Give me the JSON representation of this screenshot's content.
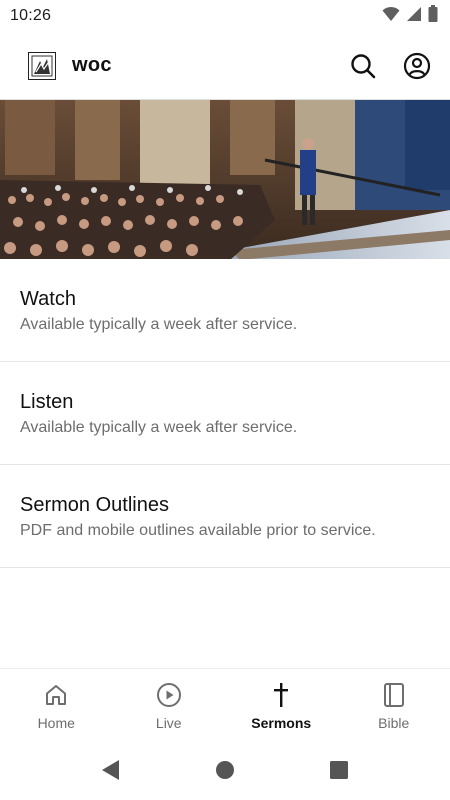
{
  "status_bar": {
    "time": "10:26",
    "icons": [
      "wifi-icon",
      "cell-signal-icon",
      "battery-icon"
    ]
  },
  "app_bar": {
    "logo_icon": "church-logo-icon",
    "title": "woc",
    "actions": [
      "search-icon",
      "account-icon"
    ]
  },
  "hero": {
    "image": "congregation-photo"
  },
  "menu": {
    "items": [
      {
        "title": "Watch",
        "subtitle": "Available typically a week after service."
      },
      {
        "title": "Listen",
        "subtitle": "Available typically a week after service."
      },
      {
        "title": "Sermon Outlines",
        "subtitle": "PDF and mobile outlines available prior to service."
      }
    ]
  },
  "bottom_nav": {
    "items": [
      {
        "label": "Home",
        "icon": "home-icon"
      },
      {
        "label": "Live",
        "icon": "play-circle-icon"
      },
      {
        "label": "Sermons",
        "icon": "cross-icon",
        "active": true
      },
      {
        "label": "Bible",
        "icon": "book-icon"
      }
    ]
  },
  "system_nav": [
    "back-icon",
    "home-circle-icon",
    "recents-icon"
  ],
  "colors": {
    "text_primary": "#111111",
    "text_secondary": "#6d6d6d",
    "divider": "#e4e4e4"
  }
}
